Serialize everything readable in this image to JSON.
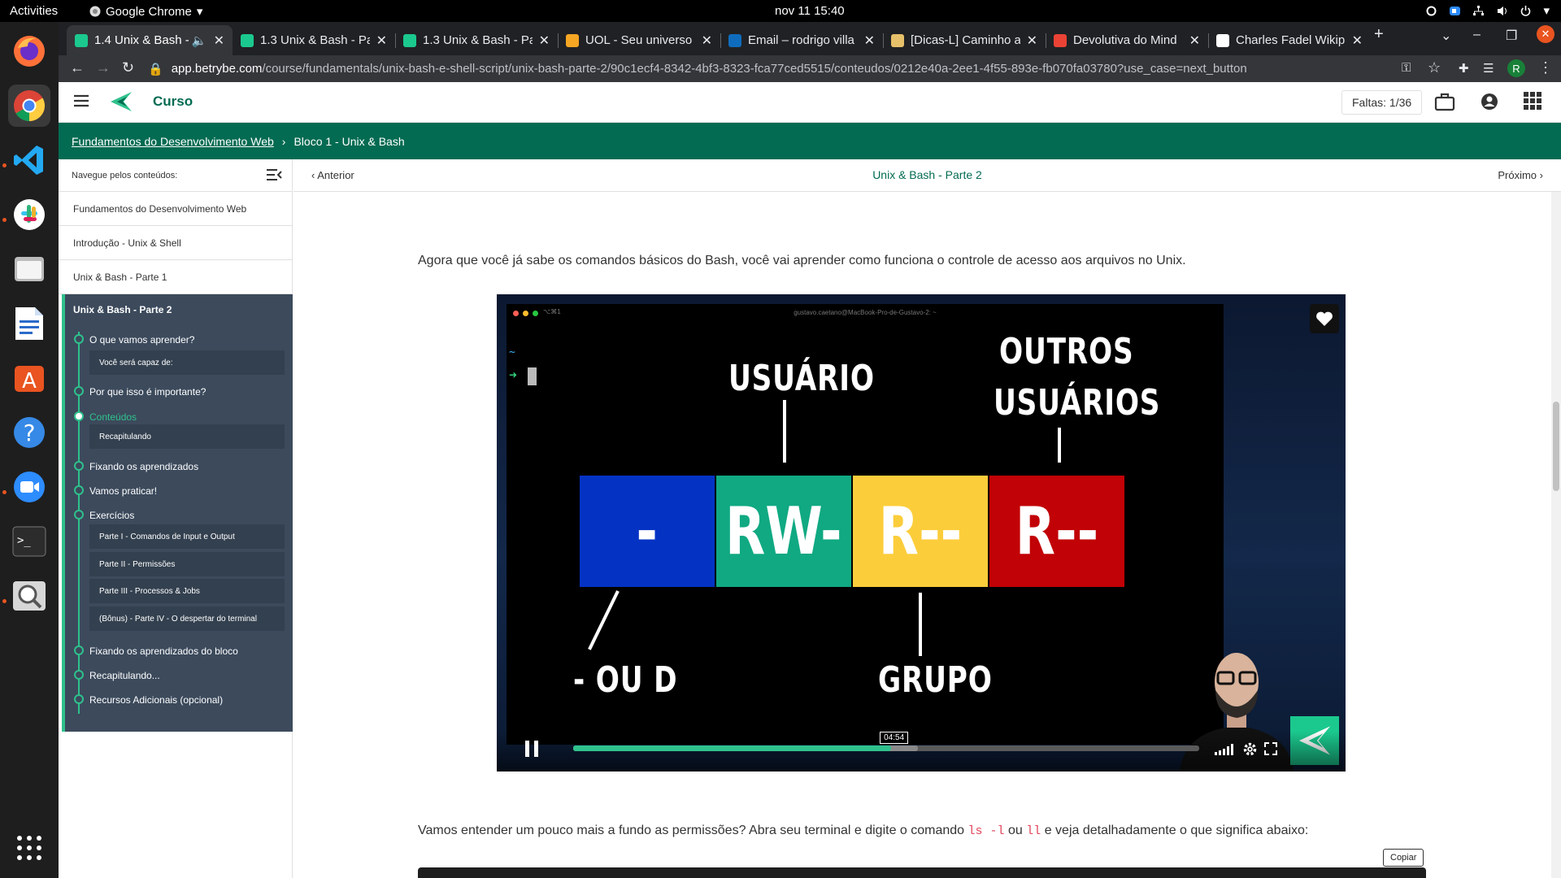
{
  "system": {
    "activities": "Activities",
    "app_menu": "Google Chrome",
    "clock": "nov 11  15:40"
  },
  "browser": {
    "tabs": [
      {
        "title": "1.4 Unix & Bash -",
        "favicon_color": "#1bc98e",
        "active": true
      },
      {
        "title": "1.3 Unix & Bash - Pa",
        "favicon_color": "#1bc98e"
      },
      {
        "title": "1.3 Unix & Bash - Pa",
        "favicon_color": "#1bc98e"
      },
      {
        "title": "UOL - Seu universo o",
        "favicon_color": "#f5a623"
      },
      {
        "title": "Email – rodrigo villa",
        "favicon_color": "#0f6cbd"
      },
      {
        "title": "[Dicas-L] Caminho a",
        "favicon_color": "#e7c16a"
      },
      {
        "title": "Devolutiva do Mind",
        "favicon_color": "#ea4335"
      },
      {
        "title": "Charles Fadel Wikip",
        "favicon_color": "#ffffff"
      }
    ],
    "url_host": "app.betrybe.com",
    "url_path": "/course/fundamentals/unix-bash-e-shell-script/unix-bash-parte-2/90c1ecf4-8342-4bf3-8323-fca77ced5515/conteudos/0212e40a-2ee1-4f55-893e-fb070fa03780?use_case=next_button",
    "profile_initial": "R"
  },
  "header": {
    "title": "Curso",
    "faltas": "Faltas: 1/36"
  },
  "breadcrumb": {
    "link": "Fundamentos do Desenvolvimento Web",
    "current": "Bloco 1 - Unix & Bash"
  },
  "sidebar": {
    "nav_label": "Navegue pelos conteúdos:",
    "links": [
      "Fundamentos do Desenvolvimento Web",
      "Introdução - Unix & Shell",
      "Unix & Bash - Parte 1"
    ],
    "active_title": "Unix & Bash - Parte 2",
    "sections": {
      "s1": "O que vamos aprender?",
      "s1_sub": "Você será capaz de:",
      "s2": "Por que isso é importante?",
      "s3": "Conteúdos",
      "s3_sub": "Recapitulando",
      "s4": "Fixando os aprendizados",
      "s5": "Vamos praticar!",
      "s6": "Exercícios",
      "s6_sub1": "Parte I - Comandos de Input e Output",
      "s6_sub2": "Parte II - Permissões",
      "s6_sub3": "Parte III - Processos & Jobs",
      "s6_sub4": "(Bônus) - Parte IV - O despertar do terminal",
      "s7": "Fixando os aprendizados do bloco",
      "s8": "Recapitulando...",
      "s9": "Recursos Adicionais (opcional)"
    }
  },
  "content_nav": {
    "prev": "Anterior",
    "title": "Unix & Bash - Parte 2",
    "next": "Próximo"
  },
  "content": {
    "intro": "Agora que você já sabe os comandos básicos do Bash, você vai aprender como funciona o controle de acesso aos arquivos no Unix.",
    "para2_a": "Vamos entender um pouco mais a fundo as permissões? Abra seu terminal e digite o comando ",
    "code1": "ls -l",
    "para2_b": " ou ",
    "code2": "ll",
    "para2_c": " e veja detalhadamente o que significa abaixo:",
    "copy": "Copiar"
  },
  "video": {
    "term_tab": "⌥⌘1",
    "term_host": "gustavo.caetano@MacBook-Pro-de-Gustavo-2: ~",
    "prompt_tilde": "~",
    "prompt_arrow": "➜",
    "label_usuario": "USUÁRIO",
    "label_outros_1": "OUTROS",
    "label_outros_2": "USUÁRIOS",
    "label_tipo": "- OU D",
    "label_grupo": "GRUPO",
    "boxes": [
      {
        "text": "-",
        "color": "#0433c4"
      },
      {
        "text": "RW-",
        "color": "#10a982"
      },
      {
        "text": "R--",
        "color": "#fccd3b"
      },
      {
        "text": "R--",
        "color": "#c10206"
      }
    ],
    "timecode": "04:54",
    "progress": 0.508,
    "buffered": 0.55
  }
}
